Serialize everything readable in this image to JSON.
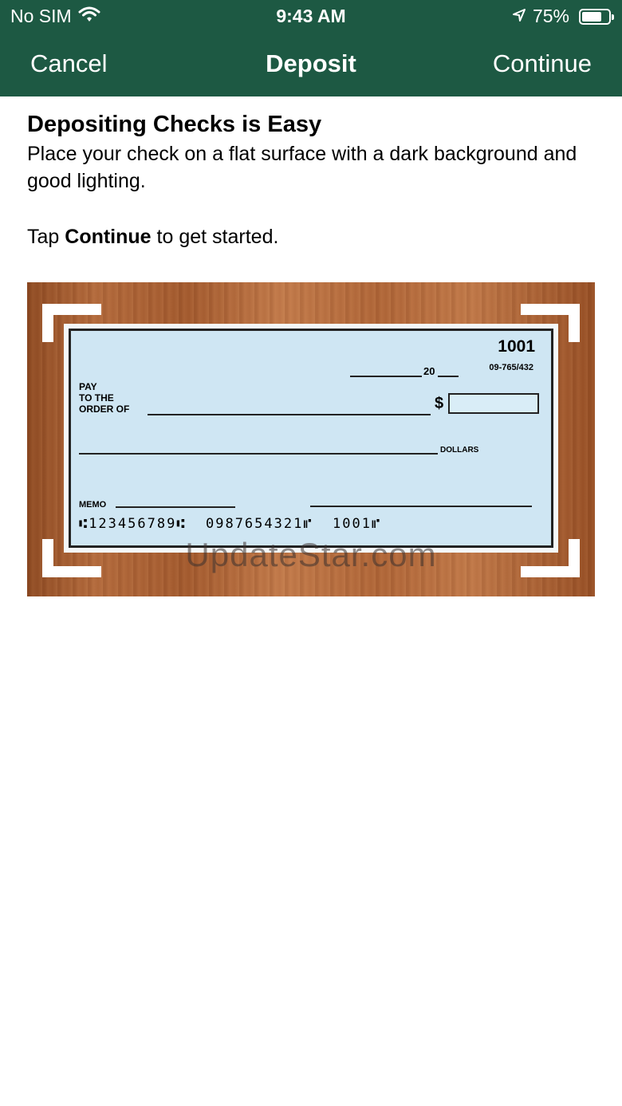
{
  "status_bar": {
    "carrier": "No SIM",
    "time": "9:43 AM",
    "battery_percent": "75%",
    "battery_level": 0.75
  },
  "nav": {
    "cancel_label": "Cancel",
    "title": "Deposit",
    "continue_label": "Continue"
  },
  "content": {
    "heading": "Depositing Checks is Easy",
    "description": "Place your check on a flat surface with a dark background and good lighting.",
    "tap_prefix": "Tap",
    "tap_bold": "Continue",
    "tap_suffix": "to get started."
  },
  "check": {
    "number": "1001",
    "date_year_prefix": "20",
    "routing_fraction": "09-765/432",
    "pay_to_line1": "PAY",
    "pay_to_line2": "TO THE",
    "pay_to_line3": "ORDER OF",
    "dollar_sign": "$",
    "dollars_label": "DOLLARS",
    "memo_label": "MEMO",
    "micr_line": "⑆123456789⑆  0987654321⑈  1001⑈"
  },
  "watermark": "UpdateStar.com",
  "colors": {
    "header_green": "#1d5943",
    "check_blue": "#cfe6f3"
  },
  "icons": {
    "wifi": "wifi-icon",
    "location": "location-arrow-icon",
    "battery": "battery-icon"
  }
}
